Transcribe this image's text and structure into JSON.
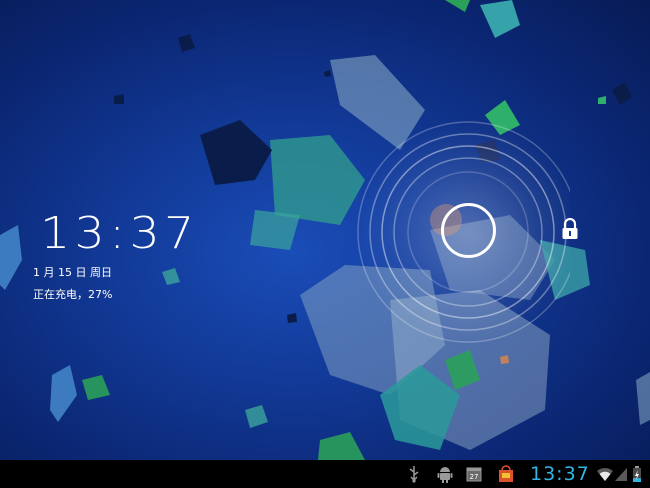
{
  "lockscreen": {
    "time": "13:37",
    "date": "1 月 15 日 周日",
    "charging_status": "正在充电，27%"
  },
  "statusbar": {
    "time": "13:37",
    "calendar_day": "27",
    "battery_level": 0.27,
    "icons": [
      "usb-icon",
      "android-debug-icon",
      "calendar-icon",
      "store-icon",
      "wifi-icon",
      "signal-icon",
      "battery-charging-icon"
    ]
  },
  "colors": {
    "accent": "#33b5e5",
    "background": "#0b2774"
  }
}
